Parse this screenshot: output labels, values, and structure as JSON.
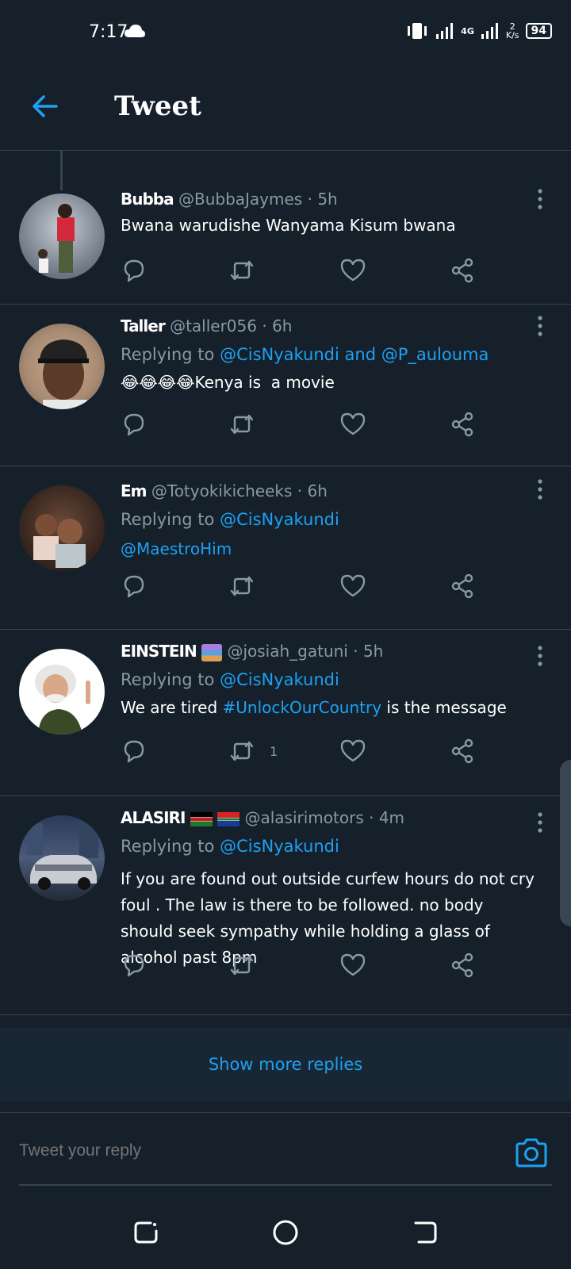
{
  "status": {
    "time": "7:17",
    "net_type": "4G",
    "speed_value": "2",
    "speed_unit": "K/s",
    "battery": "94"
  },
  "header": {
    "title": "Tweet"
  },
  "tweets": [
    {
      "name": "Bubba",
      "handle": "@BubbaJaymes",
      "time": "5h",
      "text": "Bwana warudishe Wanyama Kisum bwana"
    },
    {
      "name": "Taller",
      "handle": "@taller056",
      "time": "6h",
      "reply_prefix": "Replying to",
      "reply_link1": "@CisNyakundi",
      "reply_and": " and ",
      "reply_link2": "@P_aulouma",
      "emoji": "😂😂😂😂",
      "text": "Kenya is  a movie"
    },
    {
      "name": "Em",
      "handle": "@Totyokikicheeks",
      "time": "6h",
      "reply_prefix": "Replying to",
      "reply_link1": "@CisNyakundi",
      "text_link": "@MaestroHim"
    },
    {
      "name": "EINSTEIN",
      "handle": "@josiah_gatuni",
      "time": "5h",
      "reply_prefix": "Replying to",
      "reply_link1": "@CisNyakundi",
      "text_a": "We are tired ",
      "hashtag": "#UnlockOurCountry",
      "text_b": " is the message",
      "retweets": "1"
    },
    {
      "name": "ALASIRI",
      "handle": "@alasirimotors",
      "time": "4m",
      "reply_prefix": "Replying to",
      "reply_link1": "@CisNyakundi",
      "text": "If you are found out outside curfew hours do not cry foul . The law is there to be followed. no body should seek sympathy while holding a glass of alcohol past 8pm"
    }
  ],
  "show_more": "Show more replies",
  "composer": {
    "placeholder": "Tweet your reply"
  },
  "colors": {
    "background": "#15202b",
    "accent": "#1da1f2",
    "secondary_text": "#8899a6",
    "divider": "#38444d"
  },
  "sep": "·"
}
